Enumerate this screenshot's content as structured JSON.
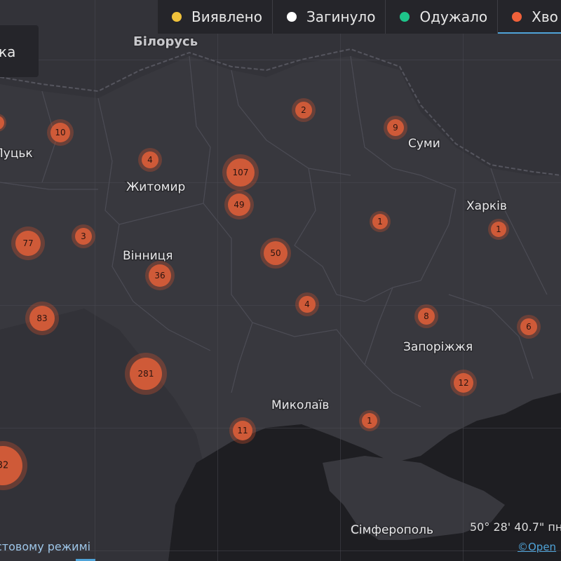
{
  "legend": [
    {
      "label": "Виявлено",
      "color": "#f0c23b"
    },
    {
      "label": "Загинуло",
      "color": "#ffffff"
    },
    {
      "label": "Одужало",
      "color": "#1ec48a"
    },
    {
      "label": "Хво",
      "color": "#f0613a"
    }
  ],
  "info_panel_text": "ка",
  "country_label": "Білорусь",
  "cities": [
    "Луцьк",
    "Житомир",
    "Вінниця",
    "Суми",
    "Харків",
    "Запоріжжя",
    "Миколаїв",
    "Сімферополь"
  ],
  "clusters": [
    "10",
    "2",
    "9",
    "4",
    "107",
    "49",
    "1",
    "1",
    "77",
    "3",
    "50",
    "36",
    "4",
    "83",
    "8",
    "6",
    "281",
    "12",
    "11",
    "1",
    "32"
  ],
  "coords_text": "50° 28' 40.7\" пн",
  "mode_link": "стовому режимі",
  "attribution": "©Open",
  "colors": {
    "land": "#3a3a40",
    "sea": "#1e1e22",
    "cluster_fill": "#cf5a38",
    "cluster_glow": "#c9502f"
  }
}
